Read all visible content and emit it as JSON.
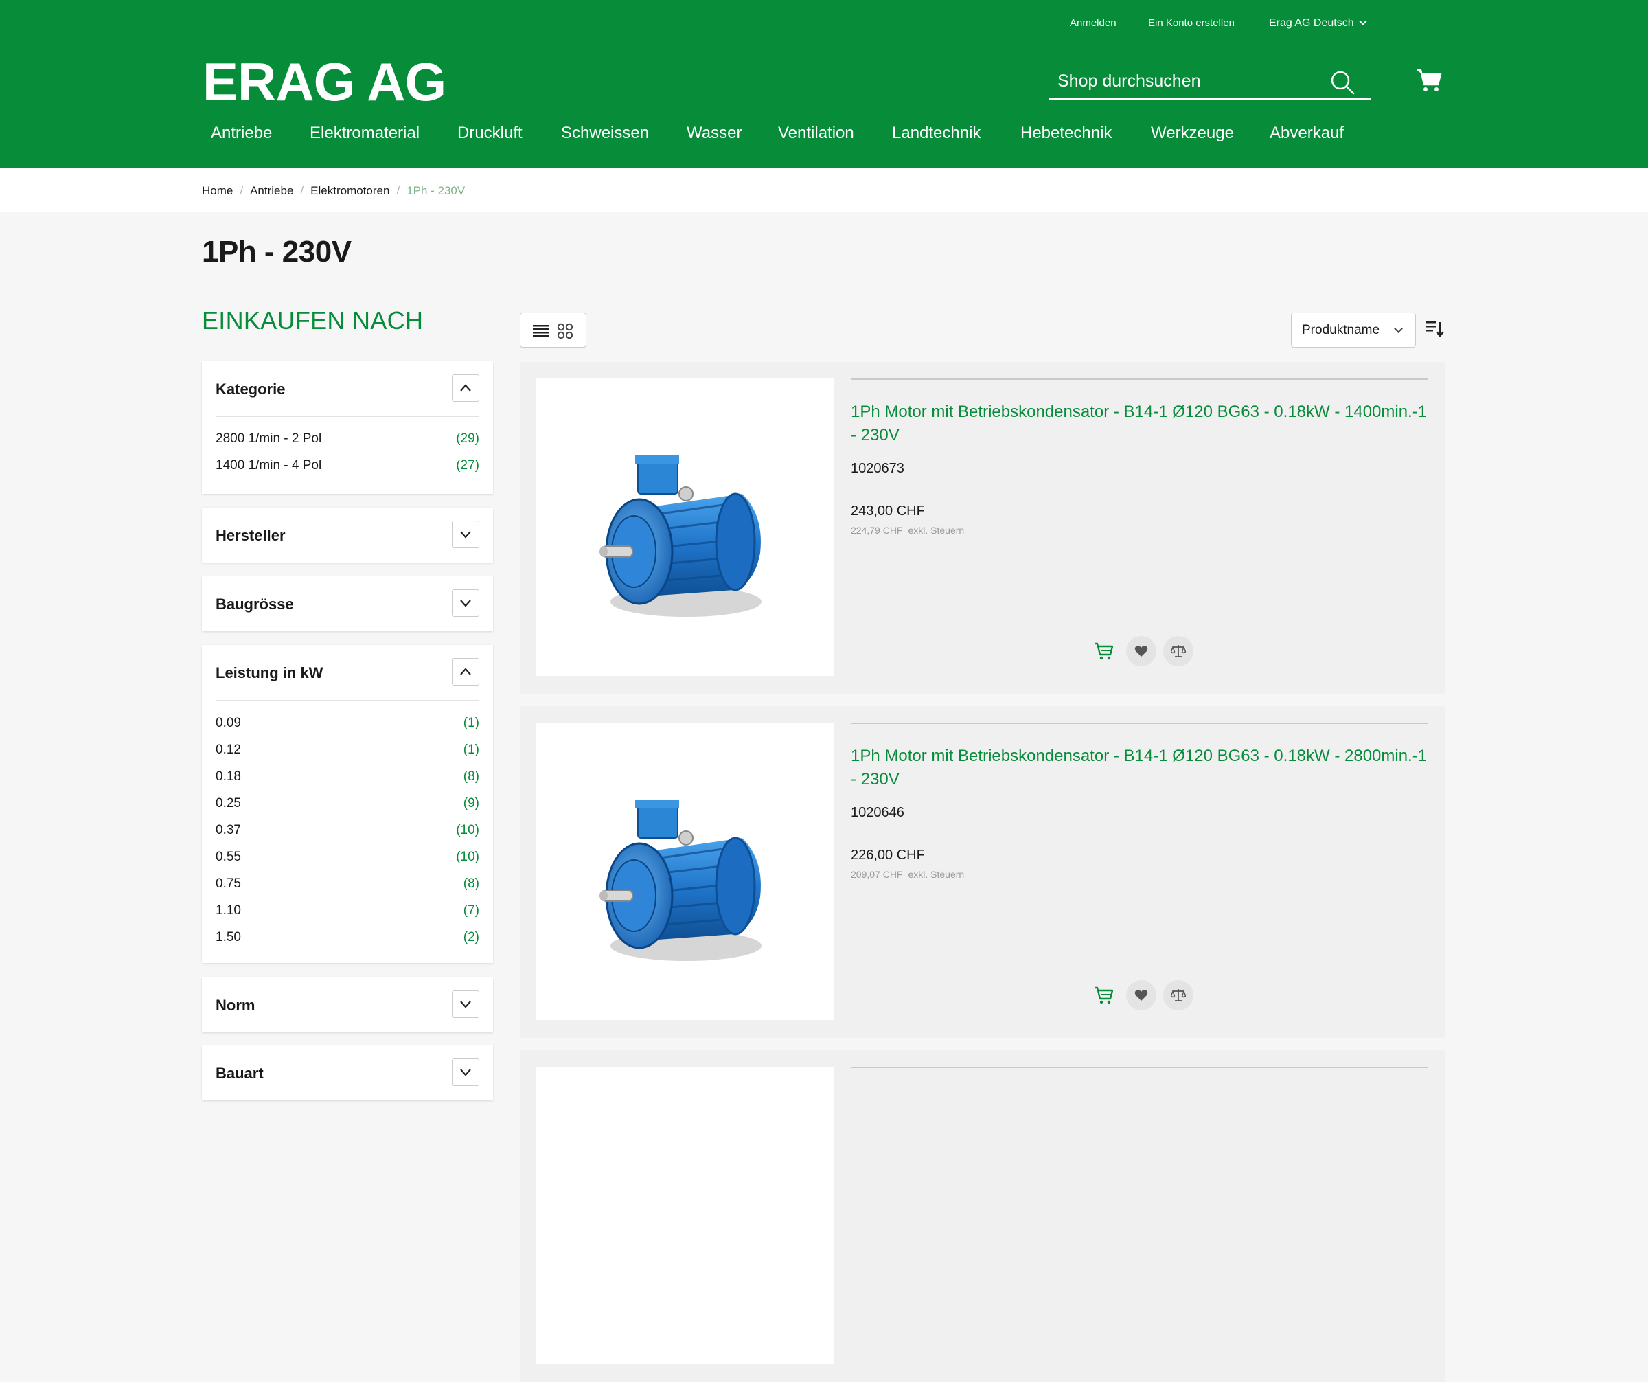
{
  "header": {
    "links": {
      "signin": "Anmelden",
      "create_account": "Ein Konto erstellen",
      "language": "Erag AG Deutsch"
    },
    "logo": "ERAG AG",
    "search": {
      "placeholder": "Shop durchsuchen"
    },
    "nav": [
      "Antriebe",
      "Elektromaterial",
      "Druckluft",
      "Schweissen",
      "Wasser",
      "Ventilation",
      "Landtechnik",
      "Hebetechnik",
      "Werkzeuge",
      "Abverkauf"
    ],
    "colors": {
      "brand": "#078c39"
    }
  },
  "breadcrumb": {
    "items": [
      "Home",
      "Antriebe",
      "Elektromotoren"
    ],
    "current": "1Ph - 230V"
  },
  "page_title": "1Ph - 230V",
  "sidebar": {
    "title": "EINKAUFEN NACH",
    "filters": [
      {
        "title": "Kategorie",
        "expanded": true,
        "options": [
          {
            "label": "2800 1/min - 2 Pol",
            "count": "(29)"
          },
          {
            "label": "1400 1/min - 4 Pol",
            "count": "(27)"
          }
        ]
      },
      {
        "title": "Hersteller",
        "expanded": false,
        "options": []
      },
      {
        "title": "Baugrösse",
        "expanded": false,
        "options": []
      },
      {
        "title": "Leistung in kW",
        "expanded": true,
        "options": [
          {
            "label": "0.09",
            "count": "(1)"
          },
          {
            "label": "0.12",
            "count": "(1)"
          },
          {
            "label": "0.18",
            "count": "(8)"
          },
          {
            "label": "0.25",
            "count": "(9)"
          },
          {
            "label": "0.37",
            "count": "(10)"
          },
          {
            "label": "0.55",
            "count": "(10)"
          },
          {
            "label": "0.75",
            "count": "(8)"
          },
          {
            "label": "1.10",
            "count": "(7)"
          },
          {
            "label": "1.50",
            "count": "(2)"
          }
        ]
      },
      {
        "title": "Norm",
        "expanded": false,
        "options": []
      },
      {
        "title": "Bauart",
        "expanded": false,
        "options": []
      }
    ]
  },
  "toolbar": {
    "sort_by": "Produktname",
    "view_modes": [
      "list-icon",
      "grid-icon"
    ]
  },
  "products": [
    {
      "name": "1Ph Motor mit Betriebskondensator - B14-1 Ø120 BG63 - 0.18kW - 1400min.-1 - 230V",
      "sku": "1020673",
      "price": "243,00 CHF",
      "price_excl": "224,79 CHF",
      "excl_label": "exkl. Steuern"
    },
    {
      "name": "1Ph Motor mit Betriebskondensator - B14-1 Ø120 BG63 - 0.18kW - 2800min.-1 - 230V",
      "sku": "1020646",
      "price": "226,00 CHF",
      "price_excl": "209,07 CHF",
      "excl_label": "exkl. Steuern"
    }
  ]
}
